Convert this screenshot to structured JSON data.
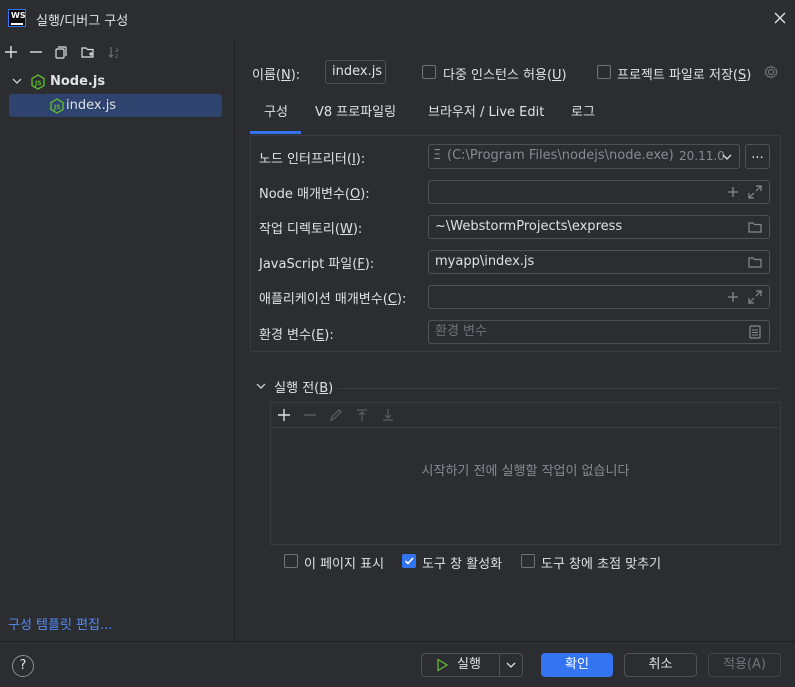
{
  "window": {
    "title": "실행/디버그 구성",
    "logo_text": "WS",
    "close_icon": "close-icon"
  },
  "sidebar": {
    "toolbar_icons": [
      "add-icon",
      "remove-icon",
      "copy-icon",
      "new-folder-icon",
      "sort-icon"
    ],
    "tree": [
      {
        "label": "Node.js",
        "icon": "nodejs-icon",
        "expanded": true
      },
      {
        "label": "index.js",
        "icon": "nodejs-icon",
        "selected": true
      }
    ],
    "templates_link": "구성 템플릿 편집..."
  },
  "header": {
    "name_label_pre": "이름(",
    "name_label_key": "N",
    "name_label_post": "):",
    "name_value": "index.js",
    "allow_parallel_pre": "다중 인스턴스 허용(",
    "allow_parallel_key": "U",
    "allow_parallel_post": ")",
    "store_project_pre": "프로젝트 파일로 저장(",
    "store_project_key": "S",
    "store_project_post": ")"
  },
  "tabs": [
    {
      "label": "구성",
      "active": true
    },
    {
      "label": "V8 프로파일링"
    },
    {
      "label": "브라우저 / Live Edit"
    },
    {
      "label": "로그"
    }
  ],
  "config": {
    "interpreter": {
      "label_pre": "노드 인터프리터(",
      "label_key": "I",
      "label_post": "):",
      "prefix": "Ξ",
      "value": "(C:\\Program Files\\nodejs\\node.exe)",
      "version": "20.11.0",
      "more_label": "..."
    },
    "node_params": {
      "label_pre": "Node 매개변수(",
      "label_key": "O",
      "label_post": "):",
      "value": ""
    },
    "working_dir": {
      "label_pre": "작업 디렉토리(",
      "label_key": "W",
      "label_post": "):",
      "value": "~\\WebstormProjects\\express"
    },
    "js_file": {
      "label_pre": "JavaScript 파일(",
      "label_key": "F",
      "label_post": "):",
      "value": "myapp\\index.js"
    },
    "app_params": {
      "label_pre": "애플리케이션 매개변수(",
      "label_key": "C",
      "label_post": "):",
      "value": ""
    },
    "env_vars": {
      "label_pre": "환경 변수(",
      "label_key": "E",
      "label_post": "):",
      "placeholder": "환경 변수"
    }
  },
  "before_launch": {
    "header_pre": "실행 전(",
    "header_key": "B",
    "header_post": ")",
    "toolbar_icons": [
      "add-icon",
      "remove-icon",
      "edit-icon",
      "move-up-icon",
      "move-down-icon"
    ],
    "empty_text": "시작하기 전에 실행할 작업이 없습니다",
    "show_page": {
      "label": "이 페이지 표시",
      "checked": false
    },
    "activate_tool": {
      "label": "도구 창 활성화",
      "checked": true
    },
    "focus_tool": {
      "label": "도구 창에 초점 맞추기",
      "checked": false
    }
  },
  "footer": {
    "help_label": "?",
    "run_label": "실행",
    "ok_label": "확인",
    "cancel_label": "취소",
    "apply_label": "적용(A)"
  },
  "colors": {
    "accent": "#3574f0",
    "nodejs_green": "#5fb832",
    "link": "#548af7",
    "background": "#2b2d30"
  }
}
